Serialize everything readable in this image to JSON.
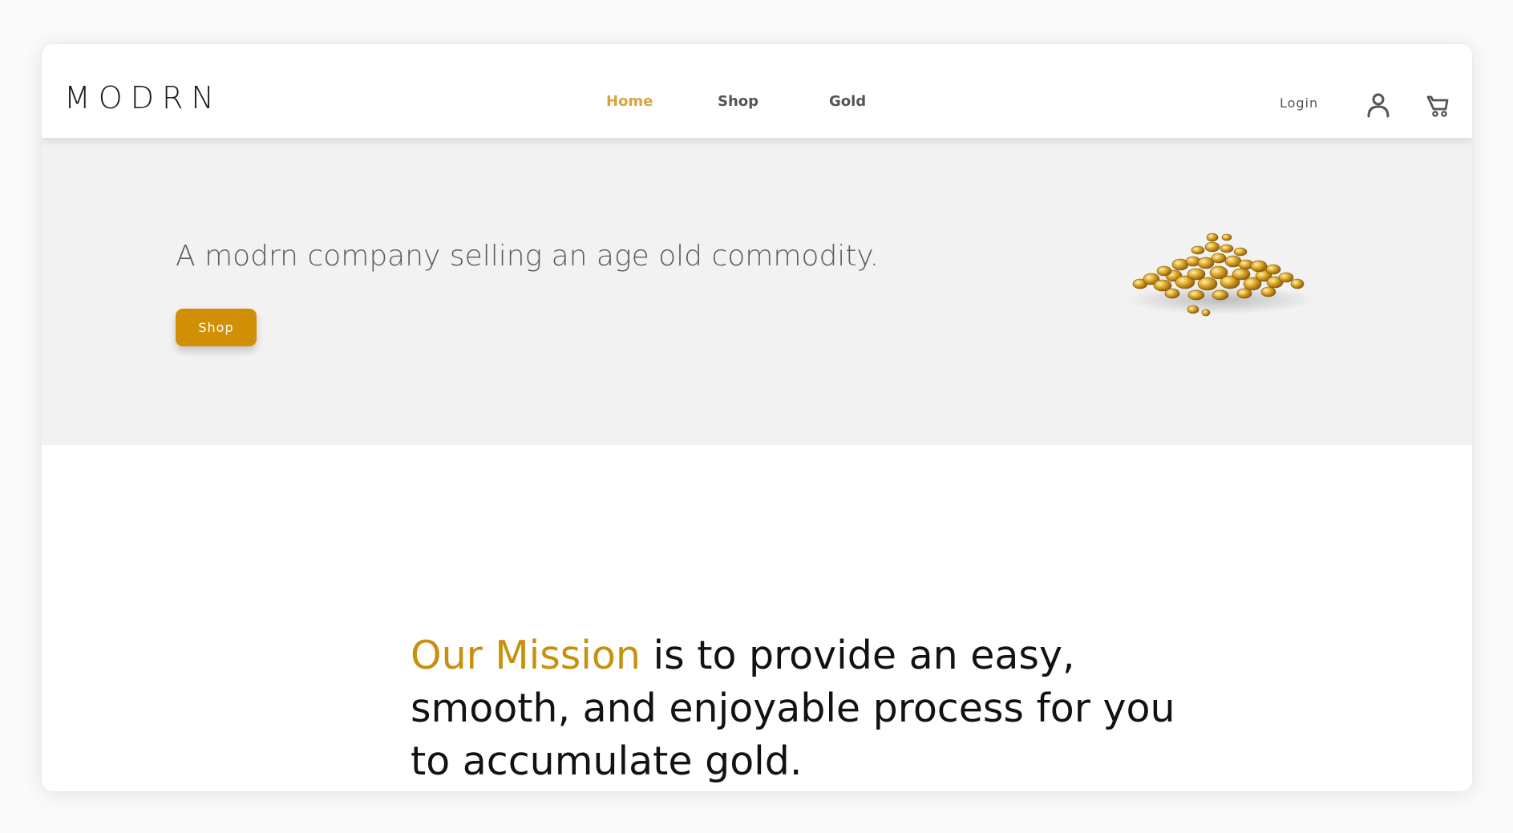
{
  "brand": {
    "logo_text": "MODRN"
  },
  "nav": {
    "items": [
      {
        "label": "Home",
        "active": true
      },
      {
        "label": "Shop",
        "active": false
      },
      {
        "label": "Gold",
        "active": false
      }
    ],
    "login_label": "Login",
    "user_icon": "user-icon",
    "cart_icon": "cart-icon"
  },
  "hero": {
    "headline": "A modrn company selling an age old commodity.",
    "cta_label": "Shop",
    "image_subject": "pile of gold granules"
  },
  "mission": {
    "highlight": "Our Mission",
    "text": " is to provide an easy, smooth, and enjoyable process for you to accumulate gold."
  },
  "colors": {
    "accent": "#d9a43a",
    "button": "#d18f06",
    "mission_highlight": "#c7900f",
    "hero_bg": "#f2f2f2",
    "text_dark": "#121212",
    "text_muted": "#5a5a5a"
  }
}
